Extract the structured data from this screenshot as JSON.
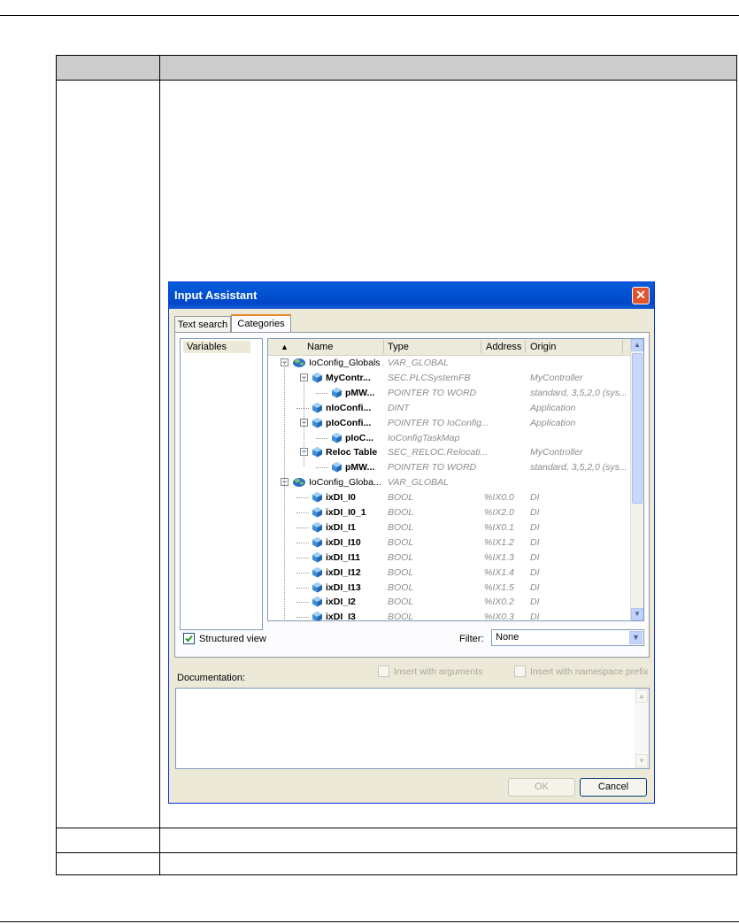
{
  "dialog": {
    "title": "Input Assistant",
    "close_glyph": "✕",
    "tabs": [
      {
        "label": "Text search"
      },
      {
        "label": "Categories"
      }
    ],
    "categories": [
      "Variables"
    ],
    "columns": {
      "sort_glyph": "▲",
      "name": "Name",
      "type": "Type",
      "address": "Address",
      "origin": "Origin"
    },
    "rows": [
      {
        "name": "IoConfig_Globals",
        "type": "VAR_GLOBAL",
        "address": "",
        "origin": "",
        "icon": "globals-icon"
      },
      {
        "name": "MyContr...",
        "type": "SEC.PLCSystemFB",
        "address": "",
        "origin": "MyController",
        "icon": "variable-icon"
      },
      {
        "name": "pMW...",
        "type": "POINTER TO WORD",
        "address": "",
        "origin": "standard, 3,5,2,0 (sys...",
        "icon": "variable-icon"
      },
      {
        "name": "nIoConfi...",
        "type": "DINT",
        "address": "",
        "origin": "Application",
        "icon": "variable-icon"
      },
      {
        "name": "pIoConfi...",
        "type": "POINTER TO IoConfig...",
        "address": "",
        "origin": "Application",
        "icon": "variable-icon"
      },
      {
        "name": "pIoC...",
        "type": "IoConfigTaskMap",
        "address": "",
        "origin": "",
        "icon": "variable-icon"
      },
      {
        "name": "Reloc Table",
        "type": "SEC_RELOC.Relocati...",
        "address": "",
        "origin": "MyController",
        "icon": "variable-icon"
      },
      {
        "name": "pMW...",
        "type": "POINTER TO WORD",
        "address": "",
        "origin": "standard, 3,5,2,0 (sys...",
        "icon": "variable-icon"
      },
      {
        "name": "IoConfig_Globa...",
        "type": "VAR_GLOBAL",
        "address": "",
        "origin": "",
        "icon": "globals-icon"
      },
      {
        "name": "ixDI_I0",
        "type": "BOOL",
        "address": "%IX0.0",
        "origin": "DI",
        "icon": "variable-icon"
      },
      {
        "name": "ixDI_I0_1",
        "type": "BOOL",
        "address": "%IX2.0",
        "origin": "DI",
        "icon": "variable-icon"
      },
      {
        "name": "ixDI_I1",
        "type": "BOOL",
        "address": "%IX0.1",
        "origin": "DI",
        "icon": "variable-icon"
      },
      {
        "name": "ixDI_I10",
        "type": "BOOL",
        "address": "%IX1.2",
        "origin": "DI",
        "icon": "variable-icon"
      },
      {
        "name": "ixDI_I11",
        "type": "BOOL",
        "address": "%IX1.3",
        "origin": "DI",
        "icon": "variable-icon"
      },
      {
        "name": "ixDI_I12",
        "type": "BOOL",
        "address": "%IX1.4",
        "origin": "DI",
        "icon": "variable-icon"
      },
      {
        "name": "ixDI_I13",
        "type": "BOOL",
        "address": "%IX1.5",
        "origin": "DI",
        "icon": "variable-icon"
      },
      {
        "name": "ixDI_I2",
        "type": "BOOL",
        "address": "%IX0.2",
        "origin": "DI",
        "icon": "variable-icon"
      },
      {
        "name": "ixDI_I3",
        "type": "BOOL",
        "address": "%IX0.3",
        "origin": "DI",
        "icon": "variable-icon"
      }
    ],
    "structured_view": {
      "label": "Structured view",
      "checked": true
    },
    "filter": {
      "label": "Filter:",
      "value": "None"
    },
    "insert_with_arguments": {
      "label": "Insert with arguments",
      "checked": false
    },
    "insert_with_namespace_prefix": {
      "label": "Insert with namespace prefix",
      "checked": false
    },
    "documentation_label": "Documentation:",
    "documentation_text": "",
    "ok_label": "OK",
    "cancel_label": "Cancel"
  },
  "colors": {
    "title_bar": "#0054e3",
    "close_button": "#e2542b",
    "active_tab_accent": "#e68b2c",
    "table_header": "#cccccc"
  }
}
